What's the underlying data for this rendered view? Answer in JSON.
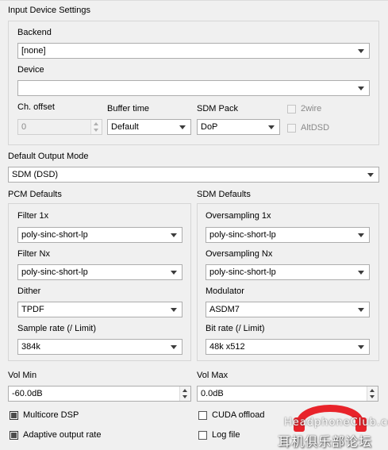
{
  "input": {
    "title": "Input Device Settings",
    "backend_label": "Backend",
    "backend_value": "[none]",
    "device_label": "Device",
    "device_value": "",
    "ch_offset_label": "Ch. offset",
    "ch_offset_value": "0",
    "buffer_time_label": "Buffer time",
    "buffer_time_value": "Default",
    "sdm_pack_label": "SDM Pack",
    "sdm_pack_value": "DoP",
    "twowire_label": "2wire",
    "altdsd_label": "AltDSD"
  },
  "output_mode": {
    "label": "Default Output Mode",
    "value": "SDM (DSD)"
  },
  "pcm": {
    "title": "PCM Defaults",
    "filter1x_label": "Filter 1x",
    "filter1x_value": "poly-sinc-short-lp",
    "filternx_label": "Filter Nx",
    "filternx_value": "poly-sinc-short-lp",
    "dither_label": "Dither",
    "dither_value": "TPDF",
    "rate_label": "Sample rate (/ Limit)",
    "rate_value": "384k"
  },
  "sdm": {
    "title": "SDM Defaults",
    "os1x_label": "Oversampling 1x",
    "os1x_value": "poly-sinc-short-lp",
    "osnx_label": "Oversampling Nx",
    "osnx_value": "poly-sinc-short-lp",
    "modulator_label": "Modulator",
    "modulator_value": "ASDM7",
    "bitrate_label": "Bit rate (/ Limit)",
    "bitrate_value": "48k x512"
  },
  "volume": {
    "min_label": "Vol Min",
    "min_value": "-60.0dB",
    "max_label": "Vol Max",
    "max_value": "0.0dB"
  },
  "options": {
    "multicore": "Multicore DSP",
    "adaptive": "Adaptive output rate",
    "cuda": "CUDA offload",
    "logfile": "Log file"
  },
  "watermark": {
    "text_line1": "HeadphoneClub.com",
    "text_line2": "耳机俱乐部论坛",
    "color": "#e8232a"
  }
}
